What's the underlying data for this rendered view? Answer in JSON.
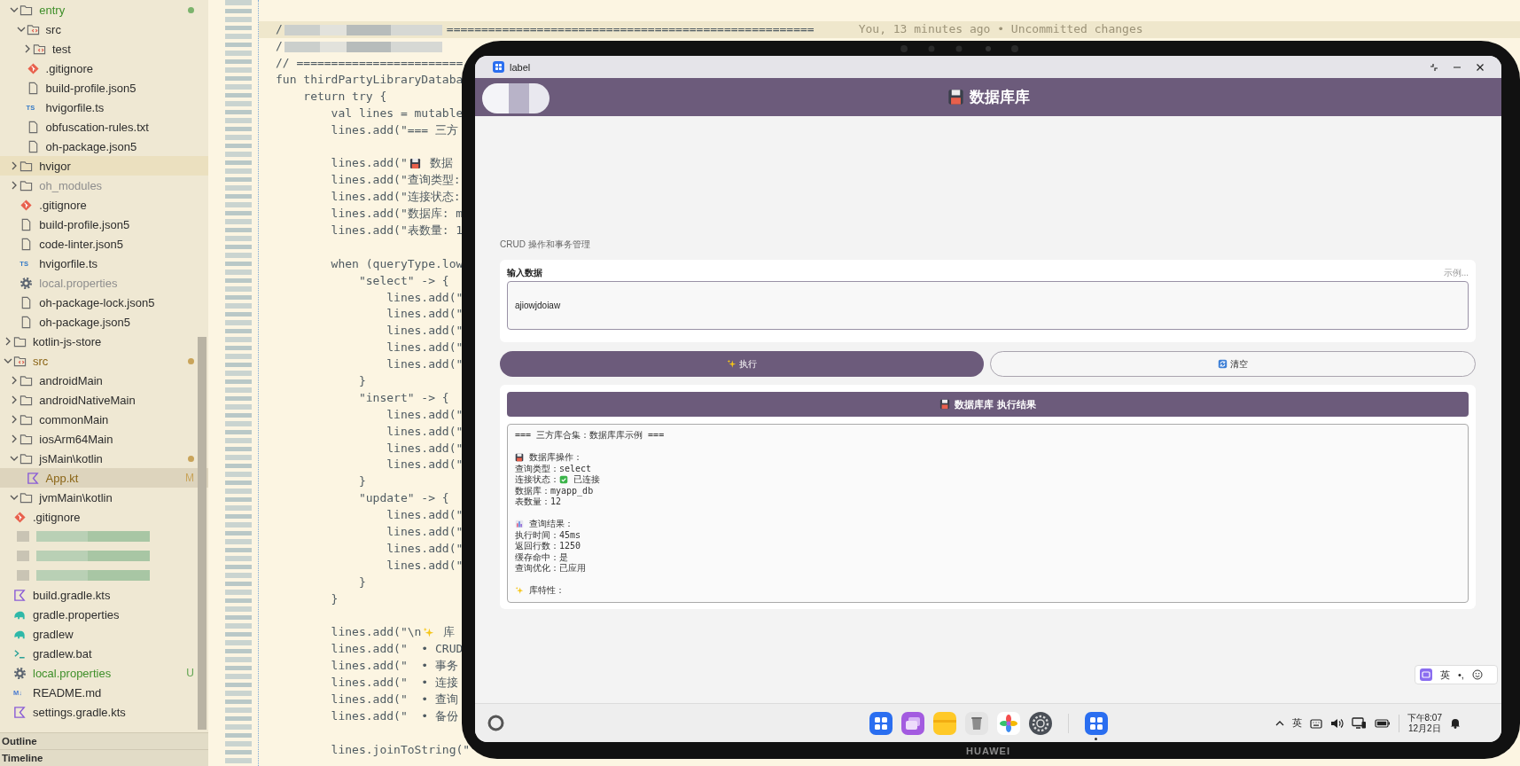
{
  "files": [
    {
      "children": [
        {
          "label": "entry",
          "kind": "folder",
          "expanded": true,
          "color": "#3f8f2a",
          "marker": {
            "color": "#7bb36c"
          },
          "selected": false,
          "hovered": false,
          "children": [
            {
              "label": "src",
              "kind": "source-folder",
              "expanded": true,
              "color": "#2d2d2d",
              "selected": false,
              "hovered": false,
              "children": [
                {
                  "label": "test",
                  "kind": "source-folder",
                  "expanded": false,
                  "color": "#2d2d2d",
                  "selected": false,
                  "hovered": false
                }
              ]
            },
            {
              "label": ".gitignore",
              "kind": "git",
              "color": "#2d2d2d",
              "selected": false,
              "hovered": false
            },
            {
              "label": "build-profile.json5",
              "kind": "file",
              "color": "#2d2d2d",
              "selected": false,
              "hovered": false
            },
            {
              "label": "hvigorfile.ts",
              "kind": "ts",
              "icon_label": "TS",
              "color": "#2d2d2d",
              "selected": false,
              "hovered": false
            },
            {
              "label": "obfuscation-rules.txt",
              "kind": "file",
              "color": "#2d2d2d",
              "selected": false,
              "hovered": false
            },
            {
              "label": "oh-package.json5",
              "kind": "file",
              "color": "#2d2d2d",
              "selected": false,
              "hovered": false
            }
          ]
        },
        {
          "label": "hvigor",
          "kind": "folder",
          "expanded": false,
          "color": "#2d2d2d",
          "selected": false,
          "hovered": true
        },
        {
          "label": "oh_modules",
          "kind": "folder",
          "expanded": false,
          "color": "#8e8e8e",
          "selected": false,
          "hovered": false
        },
        {
          "label": ".gitignore",
          "kind": "git",
          "color": "#2d2d2d",
          "selected": false,
          "hovered": false
        },
        {
          "label": "build-profile.json5",
          "kind": "file",
          "color": "#2d2d2d",
          "selected": false,
          "hovered": false
        },
        {
          "label": "code-linter.json5",
          "kind": "file",
          "color": "#2d2d2d",
          "selected": false,
          "hovered": false
        },
        {
          "label": "hvigorfile.ts",
          "kind": "ts",
          "icon_label": "TS",
          "color": "#2d2d2d",
          "selected": false,
          "hovered": false
        },
        {
          "label": "local.properties",
          "kind": "gear",
          "color": "#8e8e8e",
          "selected": false,
          "hovered": false
        },
        {
          "label": "oh-package-lock.json5",
          "kind": "file",
          "color": "#2d2d2d",
          "selected": false,
          "hovered": false
        },
        {
          "label": "oh-package.json5",
          "kind": "file",
          "color": "#2d2d2d",
          "selected": false,
          "hovered": false
        }
      ]
    },
    {
      "label": "kotlin-js-store",
      "kind": "folder",
      "expanded": false,
      "color": "#2d2d2d",
      "selected": false,
      "hovered": false
    },
    {
      "label": "src",
      "kind": "source-folder",
      "expanded": true,
      "color": "#8a6415",
      "marker": {
        "color": "#c9a45a"
      },
      "selected": false,
      "hovered": false,
      "children": [
        {
          "label": "androidMain",
          "kind": "folder",
          "expanded": false,
          "color": "#2d2d2d",
          "selected": false,
          "hovered": false
        },
        {
          "label": "androidNativeMain",
          "kind": "folder",
          "expanded": false,
          "color": "#2d2d2d",
          "selected": false,
          "hovered": false
        },
        {
          "label": "commonMain",
          "kind": "folder",
          "expanded": false,
          "color": "#2d2d2d",
          "selected": false,
          "hovered": false
        },
        {
          "label": "iosArm64Main",
          "kind": "folder",
          "expanded": false,
          "color": "#2d2d2d",
          "selected": false,
          "hovered": false
        },
        {
          "label": "jsMain\\kotlin",
          "kind": "folder",
          "expanded": true,
          "color": "#2d2d2d",
          "marker": {
            "color": "#c9a45a"
          },
          "selected": false,
          "hovered": false,
          "children": [
            {
              "label": "App.kt",
              "kind": "kotlin",
              "color": "#8a6415",
              "badge": {
                "text": "M",
                "color": "#c9a45a"
              },
              "selected": true,
              "hovered": false
            }
          ]
        },
        {
          "label": "jvmMain\\kotlin",
          "kind": "folder",
          "expanded": true,
          "color": "#2d2d2d",
          "selected": false,
          "hovered": false
        }
      ]
    },
    {
      "label": ".gitignore",
      "kind": "git",
      "color": "#2d2d2d",
      "selected": false,
      "hovered": false
    },
    {
      "kind": "redacted"
    },
    {
      "kind": "redacted"
    },
    {
      "kind": "redacted"
    },
    {
      "label": "build.gradle.kts",
      "kind": "kotlin",
      "color": "#2d2d2d",
      "selected": false,
      "hovered": false
    },
    {
      "label": "gradle.properties",
      "kind": "gradle",
      "color": "#2d2d2d",
      "selected": false,
      "hovered": false
    },
    {
      "label": "gradlew",
      "kind": "gradle",
      "color": "#2d2d2d",
      "selected": false,
      "hovered": false
    },
    {
      "label": "gradlew.bat",
      "kind": "terminal",
      "color": "#2d2d2d",
      "selected": false,
      "hovered": false
    },
    {
      "label": "local.properties",
      "kind": "gear",
      "color": "#3f8f2a",
      "badge": {
        "text": "U",
        "color": "#5fa34f"
      },
      "selected": false,
      "hovered": false
    },
    {
      "label": "README.md",
      "kind": "markdown",
      "icon_label": "M↓",
      "color": "#2d2d2d",
      "selected": false,
      "hovered": false
    },
    {
      "label": "settings.gradle.kts",
      "kind": "kotlin",
      "color": "#2d2d2d",
      "selected": false,
      "hovered": false
    }
  ],
  "sidebar_panels": [
    {
      "title": "Outline"
    },
    {
      "title": "Timeline"
    }
  ],
  "code": {
    "lines": [
      {
        "kind": "blank",
        "current": false
      },
      {
        "kind": "redacted",
        "text": "/",
        "tail": "=====================================================",
        "blame": "You, 13 minutes ago • Uncommitted changes",
        "current": true
      },
      {
        "kind": "redacted",
        "text": "/",
        "current": false
      },
      {
        "kind": "code",
        "text": "// ========================",
        "current": false
      },
      {
        "kind": "code",
        "text": "fun thirdPartyLibraryDataba",
        "current": false
      },
      {
        "kind": "code",
        "text": "    return try {",
        "current": false
      },
      {
        "kind": "code",
        "text": "        val lines = mutable",
        "current": false
      },
      {
        "kind": "code",
        "text": "        lines.add(\"=== 三方",
        "current": false
      },
      {
        "kind": "blank",
        "current": false
      },
      {
        "kind": "mixed",
        "parts": [
          {
            "kind": "text",
            "text": "        lines.add(\""
          },
          {
            "kind": "floppy"
          },
          {
            "kind": "text",
            "text": " 数据"
          }
        ],
        "current": false
      },
      {
        "kind": "code",
        "text": "        lines.add(\"查询类型:",
        "current": false
      },
      {
        "kind": "code",
        "text": "        lines.add(\"连接状态:",
        "current": false
      },
      {
        "kind": "code",
        "text": "        lines.add(\"数据库: m",
        "current": false
      },
      {
        "kind": "code",
        "text": "        lines.add(\"表数量: 1",
        "current": false
      },
      {
        "kind": "blank",
        "current": false
      },
      {
        "kind": "code",
        "text": "        when (queryType.low",
        "current": false
      },
      {
        "kind": "code",
        "text": "            \"select\" -> {",
        "current": false
      },
      {
        "kind": "code",
        "text": "                lines.add(\"",
        "current": false
      },
      {
        "kind": "code",
        "text": "                lines.add(\"",
        "current": false
      },
      {
        "kind": "code",
        "text": "                lines.add(\"",
        "current": false
      },
      {
        "kind": "code",
        "text": "                lines.add(\"",
        "current": false
      },
      {
        "kind": "code",
        "text": "                lines.add(\"",
        "current": false
      },
      {
        "kind": "code",
        "text": "            }",
        "current": false
      },
      {
        "kind": "code",
        "text": "            \"insert\" -> {",
        "current": false
      },
      {
        "kind": "code",
        "text": "                lines.add(\"",
        "current": false
      },
      {
        "kind": "code",
        "text": "                lines.add(\"",
        "current": false
      },
      {
        "kind": "code",
        "text": "                lines.add(\"",
        "current": false
      },
      {
        "kind": "code",
        "text": "                lines.add(\"",
        "current": false
      },
      {
        "kind": "code",
        "text": "            }",
        "current": false
      },
      {
        "kind": "code",
        "text": "            \"update\" -> {",
        "current": false
      },
      {
        "kind": "code",
        "text": "                lines.add(\"",
        "current": false
      },
      {
        "kind": "code",
        "text": "                lines.add(\"",
        "current": false
      },
      {
        "kind": "code",
        "text": "                lines.add(\"",
        "current": false
      },
      {
        "kind": "code",
        "text": "                lines.add(\"",
        "current": false
      },
      {
        "kind": "code",
        "text": "            }",
        "current": false
      },
      {
        "kind": "code",
        "text": "        }",
        "current": false
      },
      {
        "kind": "blank",
        "current": false
      },
      {
        "kind": "mixed",
        "parts": [
          {
            "kind": "text",
            "text": "        lines.add(\"\\n"
          },
          {
            "kind": "sparkles"
          },
          {
            "kind": "text",
            "text": " 库"
          }
        ],
        "current": false
      },
      {
        "kind": "code",
        "text": "        lines.add(\"  • CRUD",
        "current": false
      },
      {
        "kind": "code",
        "text": "        lines.add(\"  • 事务",
        "current": false
      },
      {
        "kind": "code",
        "text": "        lines.add(\"  • 连接",
        "current": false
      },
      {
        "kind": "code",
        "text": "        lines.add(\"  • 查询",
        "current": false
      },
      {
        "kind": "code",
        "text": "        lines.add(\"  • 备份",
        "current": false
      },
      {
        "kind": "blank",
        "current": false
      },
      {
        "kind": "code",
        "text": "        lines.joinToString(\"",
        "current": false
      }
    ]
  },
  "device": {
    "brand": "HUAWEI",
    "window": {
      "title": "label"
    },
    "app": {
      "title": "数据库库",
      "subtitle": "CRUD 操作和事务管理",
      "input": {
        "label": "输入数据",
        "hint": "示例...",
        "value": "ajiowjdoiaw"
      },
      "buttons": [
        {
          "label": "执行",
          "kind": "primary"
        },
        {
          "label": "清空",
          "kind": "secondary"
        }
      ],
      "result": {
        "title": "数据库库 执行结果",
        "lines": [
          {
            "kind": "text",
            "text": "=== 三方库合集：数据库库示例 ==="
          },
          {
            "kind": "blank"
          },
          {
            "kind": "mixed",
            "parts": [
              {
                "kind": "floppy"
              },
              {
                "kind": "text",
                "text": " 数据库操作："
              }
            ]
          },
          {
            "kind": "text",
            "text": "查询类型：select"
          },
          {
            "kind": "mixed",
            "parts": [
              {
                "kind": "text",
                "text": "连接状态："
              },
              {
                "kind": "check"
              },
              {
                "kind": "text",
                "text": " 已连接"
              }
            ]
          },
          {
            "kind": "text",
            "text": "数据库：myapp_db"
          },
          {
            "kind": "text",
            "text": "表数量：12"
          },
          {
            "kind": "blank"
          },
          {
            "kind": "mixed",
            "parts": [
              {
                "kind": "chart"
              },
              {
                "kind": "text",
                "text": " 查询结果："
              }
            ]
          },
          {
            "kind": "text",
            "text": "执行时间：45ms"
          },
          {
            "kind": "text",
            "text": "返回行数：1250"
          },
          {
            "kind": "text",
            "text": "缓存命中：是"
          },
          {
            "kind": "text",
            "text": "查询优化：已应用"
          },
          {
            "kind": "blank"
          },
          {
            "kind": "mixed",
            "parts": [
              {
                "kind": "sparkles"
              },
              {
                "kind": "text",
                "text": " 库特性："
              }
            ]
          }
        ]
      }
    },
    "ime_toolbar": {
      "mode": "英",
      "punctuation": "•,"
    },
    "taskbar": {
      "dock": [
        {
          "kind": "grid"
        },
        {
          "kind": "windows"
        },
        {
          "kind": "folder"
        },
        {
          "kind": "trash"
        },
        {
          "kind": "pinwheel"
        },
        {
          "kind": "settings"
        }
      ],
      "running_apps": [
        {
          "kind": "grid",
          "running": true
        }
      ],
      "tray": {
        "input_method": "英",
        "time": "下午8:07",
        "date": "12月2日"
      }
    }
  }
}
